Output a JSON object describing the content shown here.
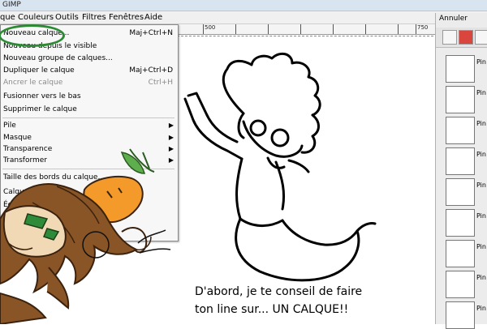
{
  "window": {
    "title": "GIMP"
  },
  "menubar": [
    "que",
    "Couleurs",
    "Outils",
    "Filtres",
    "Fenêtres",
    "Aide"
  ],
  "ruler": {
    "labels": [
      "500",
      "750"
    ]
  },
  "menu": {
    "items": [
      {
        "label": "Nouveau calque...",
        "shortcut": "Maj+Ctrl+N"
      },
      {
        "label": "Nouveau depuis le visible",
        "shortcut": ""
      },
      {
        "label": "Nouveau groupe de calques...",
        "shortcut": ""
      },
      {
        "label": "Dupliquer le calque",
        "shortcut": "Maj+Ctrl+D"
      },
      {
        "label": "Ancrer le calque",
        "shortcut": "Ctrl+H"
      },
      {
        "label": "Fusionner vers le bas",
        "shortcut": ""
      },
      {
        "label": "Supprimer le calque",
        "shortcut": ""
      },
      {
        "label": "Pile",
        "shortcut": ""
      },
      {
        "label": "Masque",
        "shortcut": ""
      },
      {
        "label": "Transparence",
        "shortcut": ""
      },
      {
        "label": "Transformer",
        "shortcut": ""
      },
      {
        "label": "Taille des bords du calque...",
        "shortcut": ""
      },
      {
        "label": "Calque",
        "shortcut": ""
      },
      {
        "label": "Échel",
        "shortcut": ""
      },
      {
        "label": "R",
        "shortcut": ""
      }
    ]
  },
  "panel": {
    "title": "Annuler",
    "history": [
      "Pin",
      "Pin",
      "Pin",
      "Pin",
      "Pin",
      "Pin",
      "Pin",
      "Pin",
      "Pin"
    ]
  },
  "caption": {
    "line1": "D'abord, je te conseil de faire",
    "line2": "ton line sur... UN CALQUE!!"
  }
}
